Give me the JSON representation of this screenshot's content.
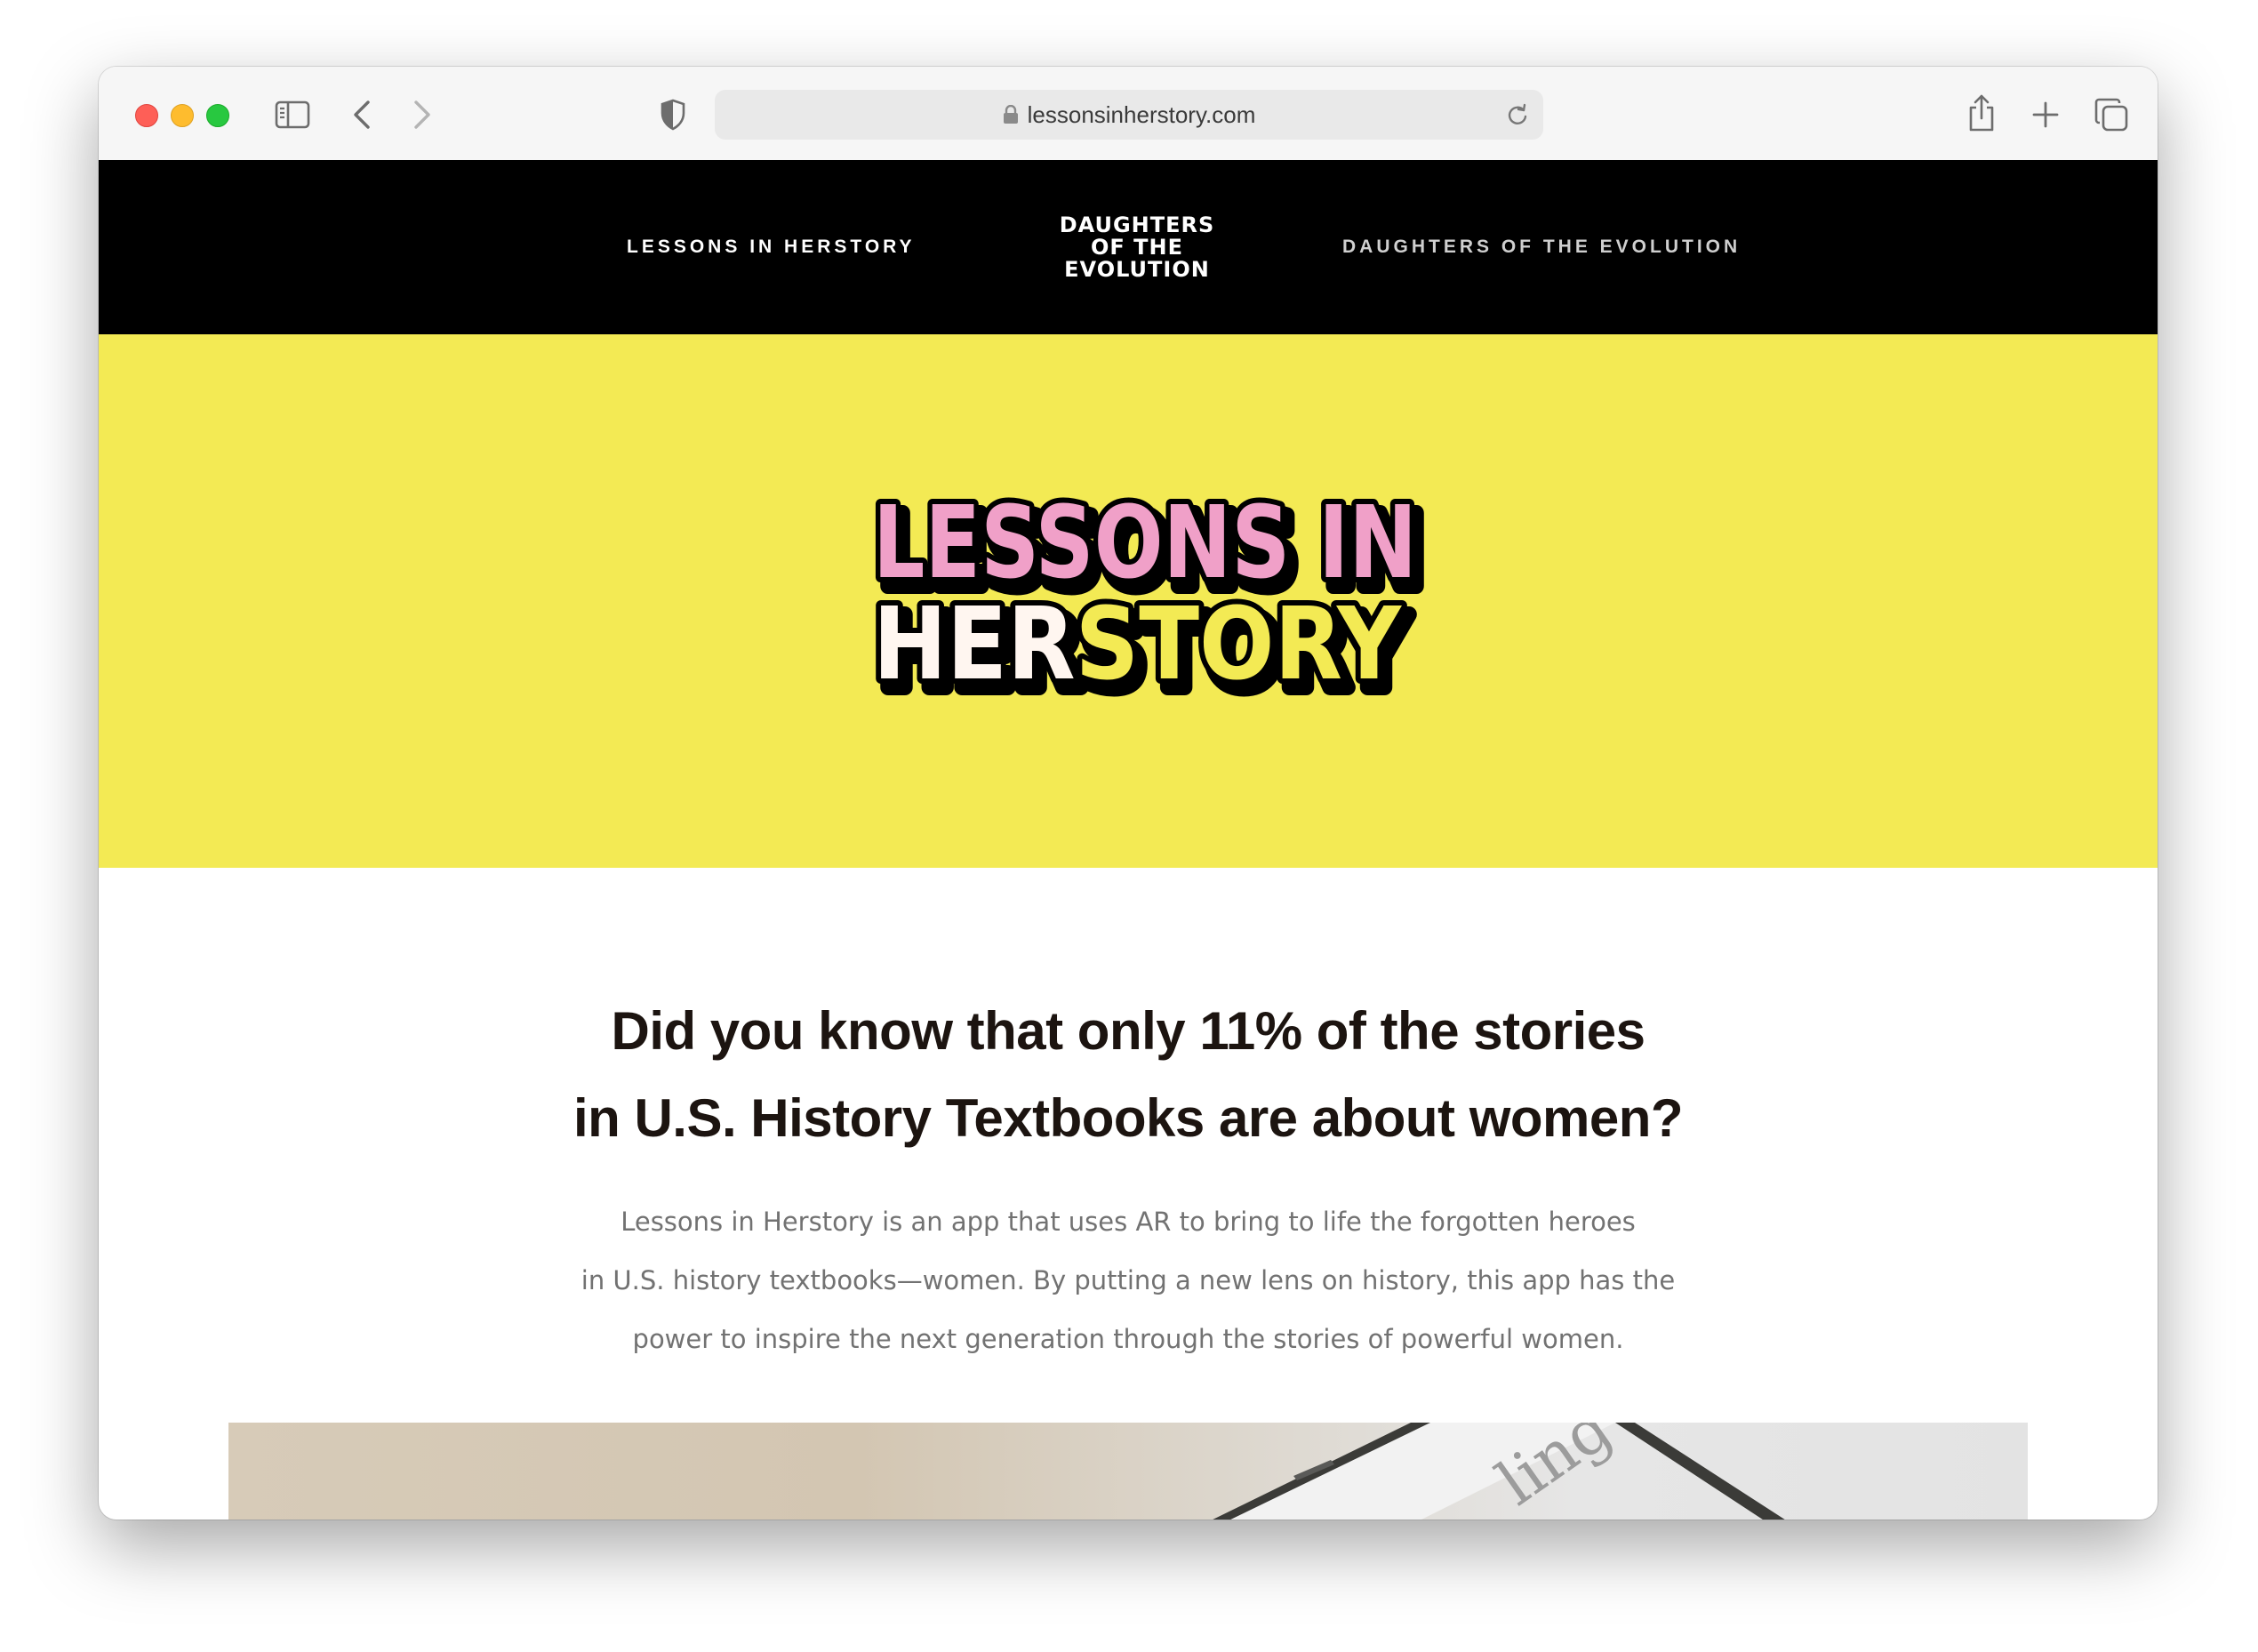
{
  "browser": {
    "url": "lessonsinherstory.com"
  },
  "nav": {
    "left_link": "LESSONS IN HERSTORY",
    "logo_lines": [
      "DAUGHTERS",
      "OF THE",
      "EVOLUTION"
    ],
    "right_link": "DAUGHTERS OF THE EVOLUTION"
  },
  "hero": {
    "logo_line1": "LESSONS IN",
    "logo_line2_a": "HER",
    "logo_line2_b": "STORY",
    "colors": {
      "background": "#f3ea54",
      "pink": "#f0a0c8",
      "white": "#fff6f0",
      "yellow": "#f3ea54",
      "outline": "#000000"
    }
  },
  "content": {
    "headline_lines": [
      "Did you know that only 11% of the stories",
      "in U.S. History Textbooks are about women?"
    ],
    "body_lines": [
      "Lessons in Herstory is an app that uses AR to bring to life the forgotten heroes",
      "in U.S. history textbooks—women. By putting a new lens on history, this app has the",
      "power to inspire the next generation through the stories of powerful women."
    ]
  }
}
